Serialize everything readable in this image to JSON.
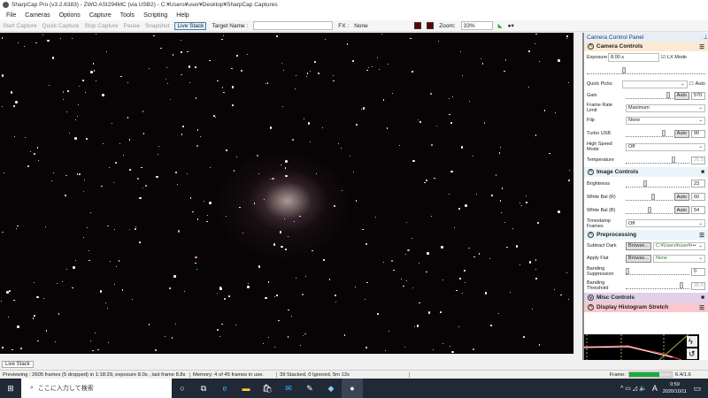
{
  "window": {
    "title": "SharpCap Pro (v3.2.6383) - ZWO ASI294MC (via USB2) - C:¥Users¥user¥Desktop¥SharpCap Captures"
  },
  "menu": [
    "File",
    "Cameras",
    "Options",
    "Capture",
    "Tools",
    "Scripting",
    "Help"
  ],
  "toolbar": {
    "start_capture": "Start Capture",
    "quick_capture": "Quick Capture",
    "stop_capture": "Stop Capture",
    "pause": "Pause",
    "snapshot": "Snapshot",
    "live_stack": "Live Stack",
    "target_label": "Target Name :",
    "fx_label": "FX :",
    "fx_value": "None",
    "zoom_label": "Zoom:",
    "zoom_value": "33%"
  },
  "panel": {
    "title": "Camera Control Panel",
    "camera_controls": {
      "title": "Camera Controls",
      "exposure_label": "Exposure",
      "exposure_value": "8.00 s",
      "lx_mode": "LX Mode",
      "quick_picks": "Quick Picks",
      "auto": "Auto",
      "gain_label": "Gain",
      "gain_value": "570",
      "frame_rate_label": "Frame Rate Limit",
      "frame_rate_value": "Maximum",
      "flip_label": "Flip",
      "flip_value": "None",
      "turbo_label": "Turbo USB",
      "turbo_value": "90",
      "hsm_label": "High Speed Mode",
      "hsm_value": "Off",
      "temp_label": "Temperature",
      "temp_value": "25.3"
    },
    "image_controls": {
      "title": "Image Controls",
      "brightness_label": "Brightness",
      "brightness_value": "23",
      "wbr_label": "White Bal (R)",
      "wbr_value": "60",
      "wbb_label": "White Bal (B)",
      "wbb_value": "54",
      "timestamp_label": "Timestamp Frames",
      "timestamp_value": "Off"
    },
    "preprocessing": {
      "title": "Preprocessing",
      "dark_label": "Subtract Dark",
      "browse": "Browse...",
      "dark_value": "C:¥Users¥user¥•••",
      "flat_label": "Apply Flat",
      "flat_value": "None",
      "bs_label": "Banding Suppression",
      "bs_value": "0",
      "bt_label": "Banding Threshold",
      "bt_value": "35.0"
    },
    "misc": {
      "title": "Misc Controls"
    },
    "histogram": {
      "title": "Display Histogram Stretch"
    }
  },
  "tab": "Live Stack",
  "status": {
    "preview": "Previewing : 2605 frames (5 dropped) in 1:18:29, exposure 8.0s , last frame 8.8s",
    "memory": "Memory: 4 of 45 frames in use.",
    "stacked": "39 Stacked, 0 Ignored, 5m 12s",
    "frame_label": "Frame:",
    "frame_progress": 0.7,
    "frame_value": "6.4/1.6"
  },
  "taskbar": {
    "search_placeholder": "ここに入力して検索",
    "time": "0:59",
    "date": "2020/10/11",
    "ime": "A"
  }
}
